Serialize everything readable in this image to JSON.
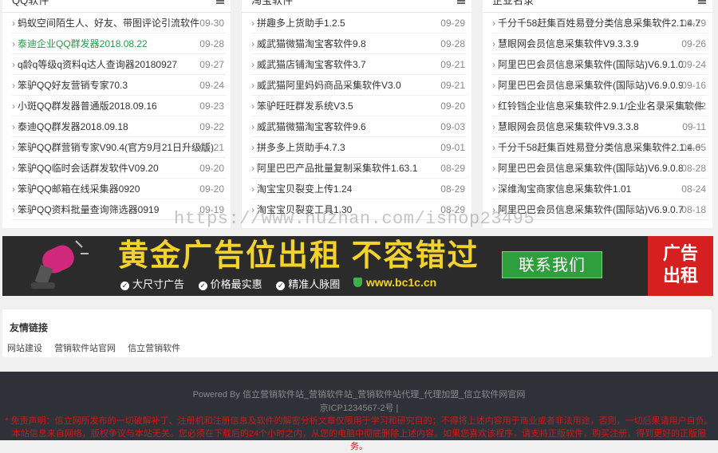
{
  "columns": [
    {
      "title": "QQ软件",
      "items": [
        {
          "text": "蚂蚁空间陌生人、好友、带图评论引流软件",
          "date": "09-30"
        },
        {
          "text": "泰迪企业QQ群发器2018.08.22",
          "date": "09-28",
          "green": true
        },
        {
          "text": "q龄q等级q资料q达人查询器20180927",
          "date": "09-27"
        },
        {
          "text": "笨驴QQ好友营销专家70.3",
          "date": "09-24"
        },
        {
          "text": "小斑QQ群发器普通版2018.09.16",
          "date": "09-23"
        },
        {
          "text": "泰迪QQ群发器2018.09.18",
          "date": "09-22"
        },
        {
          "text": "笨驴QQ群营销专家V90.4(官方9月21日升级版)",
          "date": "09-21"
        },
        {
          "text": "笨驴QQ临时会话群发软件V09.20",
          "date": "09-20"
        },
        {
          "text": "笨驴QQ邮箱在线采集器0920",
          "date": "09-20"
        },
        {
          "text": "笨驴QQ资料批量查询筛选器0919",
          "date": "09-19"
        }
      ]
    },
    {
      "title": "淘宝软件",
      "items": [
        {
          "text": "拼趣多上货助手1.2.5",
          "date": "09-29"
        },
        {
          "text": "威武猫微猫淘宝客软件9.8",
          "date": "09-28"
        },
        {
          "text": "威武猫店铺淘宝客软件3.7",
          "date": "09-21"
        },
        {
          "text": "威武猫阿里妈妈商品采集软件V3.0",
          "date": "09-21"
        },
        {
          "text": "笨驴旺旺群发系统V3.5",
          "date": "09-20"
        },
        {
          "text": "威武猫微猫淘宝客软件9.6",
          "date": "09-03"
        },
        {
          "text": "拼多多上货助手4.7.3",
          "date": "09-01"
        },
        {
          "text": "阿里巴巴产品批量复制采集软件1.63.1",
          "date": "08-29"
        },
        {
          "text": "淘宝宝贝裂变上传1.24",
          "date": "08-29"
        },
        {
          "text": "淘宝宝贝裂变工具1.30",
          "date": "08-29"
        }
      ]
    },
    {
      "title": "企业名录",
      "items": [
        {
          "text": "千分千58赶集百姓易登分类信息采集软件2.1.4.7",
          "date": "09-29"
        },
        {
          "text": "慧眼网会员信息采集软件V9.3.3.9",
          "date": "09-26"
        },
        {
          "text": "阿里巴巴会员信息采集软件(国际站)V6.9.1.0",
          "date": "09-24"
        },
        {
          "text": "阿里巴巴会员信息采集软件(国际站)V6.9.0.9",
          "date": "09-16"
        },
        {
          "text": "红铃铛企业信息采集软件2.9.1/企业名录采集软件",
          "date": "09-12"
        },
        {
          "text": "慧眼网会员信息采集软件V9.3.3.8",
          "date": "09-11"
        },
        {
          "text": "千分千58赶集百姓易登分类信息采集软件2.1.4.6",
          "date": "09-05"
        },
        {
          "text": "阿里巴巴会员信息采集软件(国际站)V6.9.0.8",
          "date": "08-28"
        },
        {
          "text": "深维淘宝商家信息采集软件1.01",
          "date": "08-24"
        },
        {
          "text": "阿里巴巴会员信息采集软件(国际站)V6.9.0.7",
          "date": "08-18"
        }
      ]
    }
  ],
  "watermark": "https://www.huzhan.com/ishop23495",
  "banner": {
    "headline": "黄金广告位出租 不容错过",
    "features": [
      "大尺寸广告",
      "价格最实惠",
      "精准人脉圈"
    ],
    "site": "www.bc1c.cn",
    "contact": "联系我们",
    "rent_line1": "广告",
    "rent_line2": "出租"
  },
  "links": {
    "title": "友情链接",
    "items": [
      "网站建设",
      "营销软件站官网",
      "信立营销软件"
    ]
  },
  "footer": {
    "powered": "Powered By 信立营销软件站_营销软件站_营销软件站代理_代理加盟_信立软件网官网",
    "icp": "京ICP1234567-2号 |",
    "disclaimer": "* 免责声明：信立网所发布的一切破解补丁、注册机和注册信息及软件的解密分析文章仅限用于学习和研究目的；不得将上述内容用于商业或者非法用途，否则，一切后果请用户自负。本站信息来自网络，版权争议与本站无关。您必须在下载后的24个小时之内，从您的电脑中彻底删除上述内容。如果您喜欢该程序，请支持正版软件，购买注册，得到更好的正版服务。"
  },
  "colors": {
    "accent_green": "#2a9b4a",
    "banner_gold": "#f2d22b",
    "banner_red": "#d62020",
    "footer_bg": "#2e3238",
    "disclaimer_red": "#d01818"
  }
}
